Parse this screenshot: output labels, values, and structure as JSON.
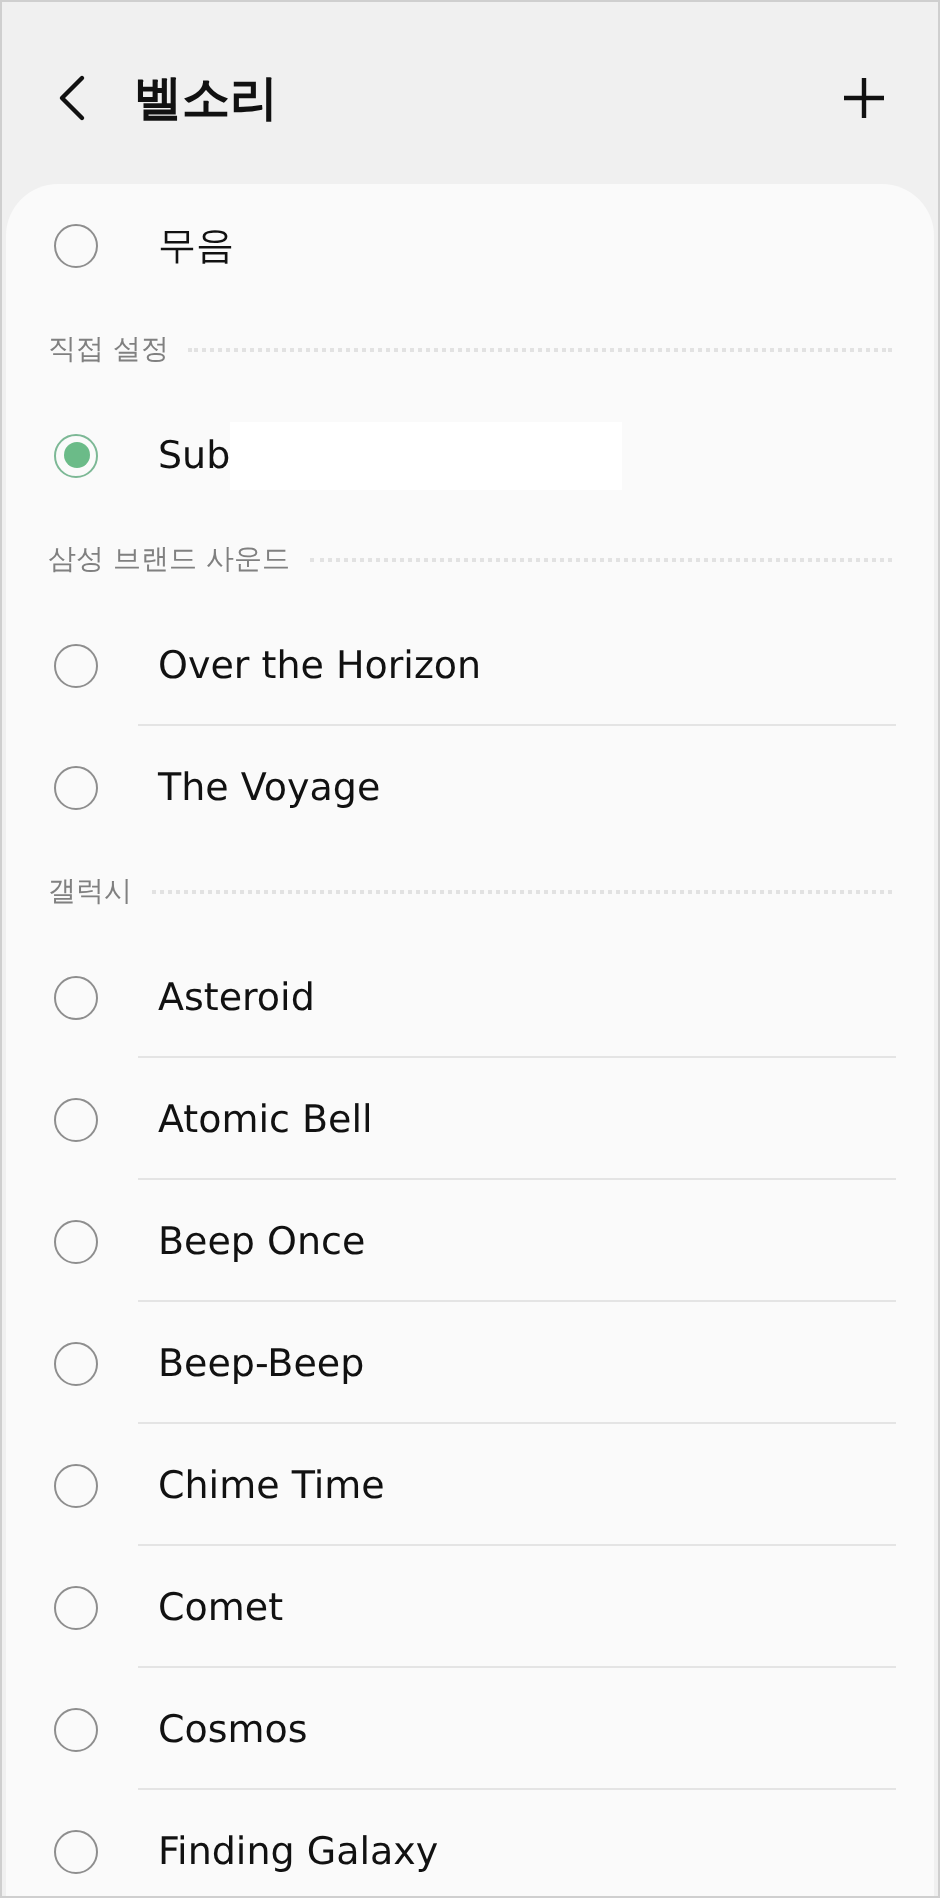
{
  "header": {
    "title": "벨소리"
  },
  "sections": [
    {
      "items": [
        {
          "label": "무음",
          "selected": false
        }
      ]
    },
    {
      "title": "직접 설정",
      "items": [
        {
          "label": "Sub",
          "selected": true,
          "redacted": true
        }
      ]
    },
    {
      "title": "삼성 브랜드 사운드",
      "items": [
        {
          "label": "Over the Horizon",
          "selected": false
        },
        {
          "label": "The Voyage",
          "selected": false
        }
      ]
    },
    {
      "title": "갤럭시",
      "items": [
        {
          "label": "Asteroid",
          "selected": false
        },
        {
          "label": "Atomic Bell",
          "selected": false
        },
        {
          "label": "Beep Once",
          "selected": false
        },
        {
          "label": "Beep-Beep",
          "selected": false
        },
        {
          "label": "Chime Time",
          "selected": false
        },
        {
          "label": "Comet",
          "selected": false
        },
        {
          "label": "Cosmos",
          "selected": false
        },
        {
          "label": "Finding Galaxy",
          "selected": false
        }
      ]
    }
  ]
}
